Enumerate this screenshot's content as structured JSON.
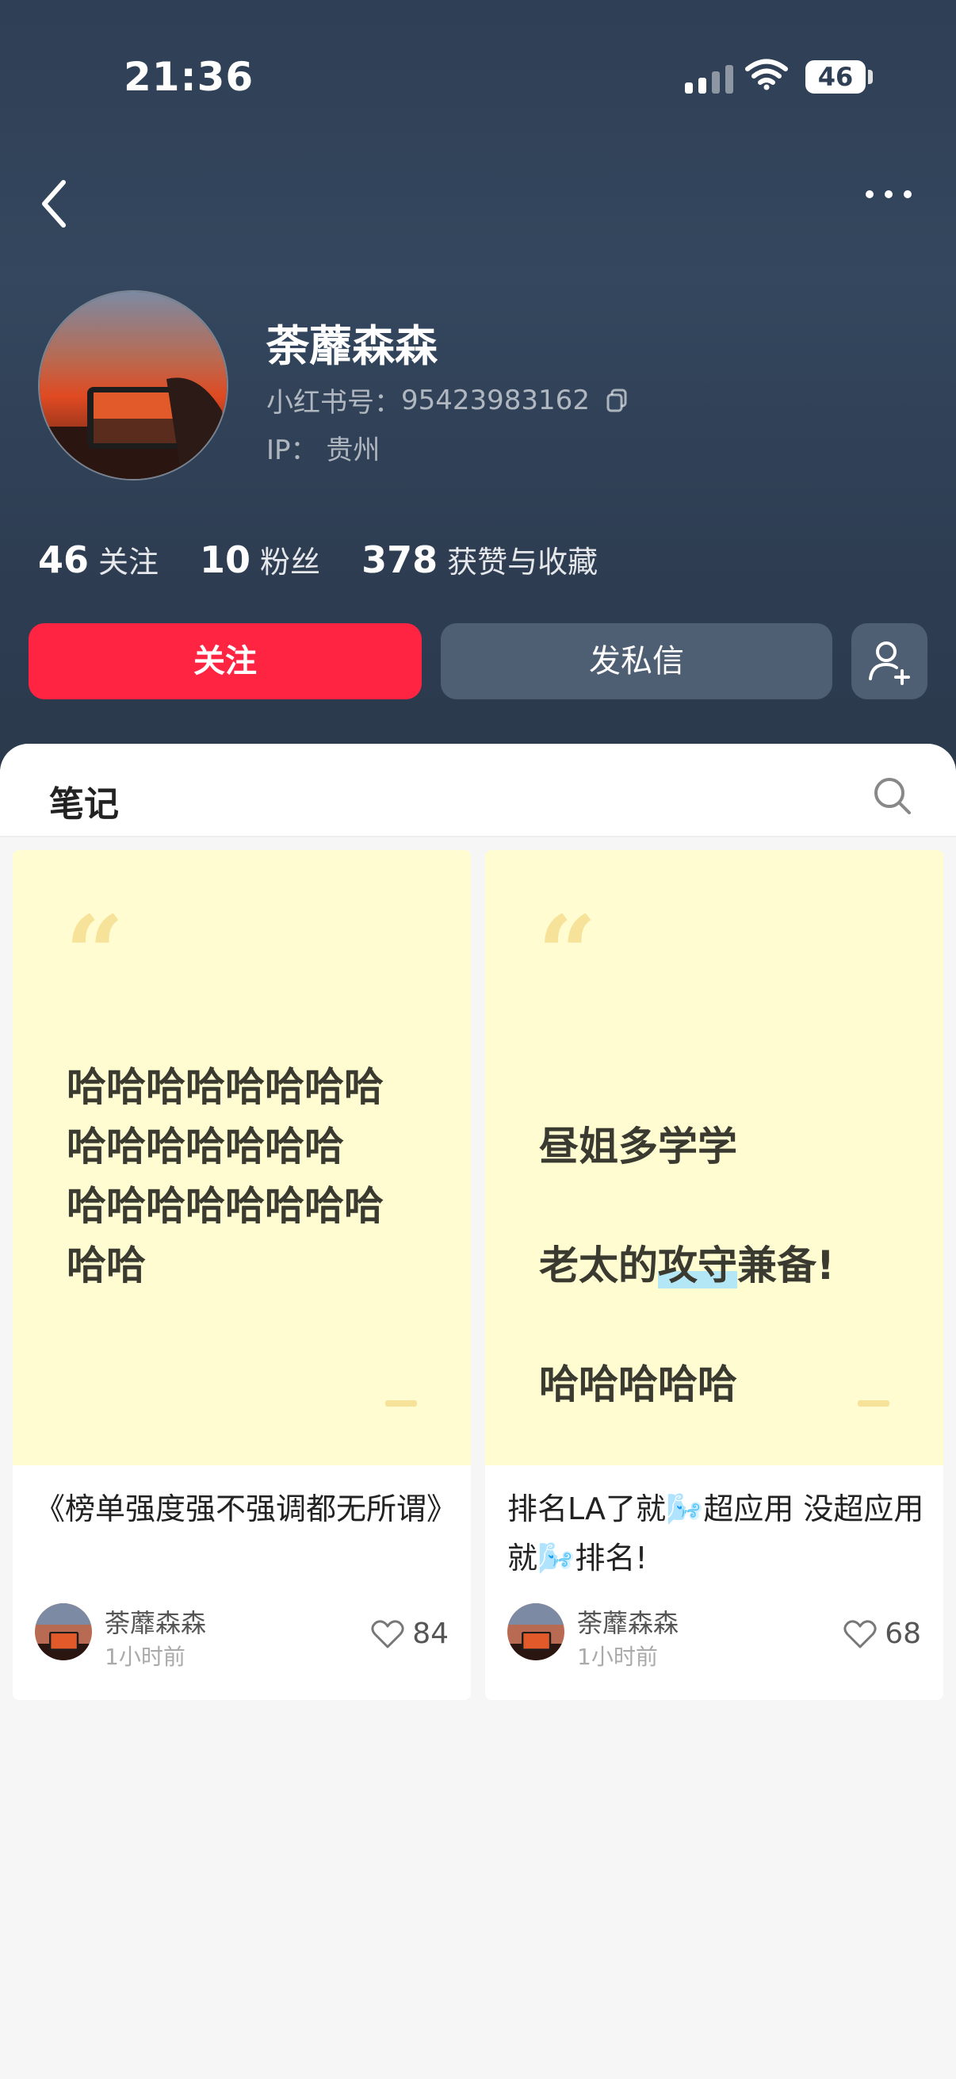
{
  "status_bar": {
    "time": "21:36",
    "battery": "46"
  },
  "profile": {
    "name": "荼蘼森森",
    "id_label": "小红书号：",
    "id_value": "95423983162",
    "ip_label": "IP：",
    "ip_value": "贵州"
  },
  "stats": [
    {
      "num": "46",
      "label": "关注"
    },
    {
      "num": "10",
      "label": "粉丝"
    },
    {
      "num": "378",
      "label": "获赞与收藏"
    }
  ],
  "actions": {
    "follow": "关注",
    "message": "发私信"
  },
  "tabs": {
    "notes": "笔记"
  },
  "notes": [
    {
      "cover_text": "哈哈哈哈哈哈哈哈\n哈哈哈哈哈哈哈\n哈哈哈哈哈哈哈哈\n哈哈",
      "title": "《榜单强度强不强调都无所谓》",
      "author": "荼蘼森森",
      "time": "1小时前",
      "likes": "84"
    },
    {
      "cover_line1": "昼姐多学学",
      "cover_line2_pre": "老太的",
      "cover_line2_hl": "攻守",
      "cover_line2_post": "兼备!",
      "cover_line3": "哈哈哈哈哈",
      "title": "排名LA了就🌬️超应用 没超应用就🌬️排名!",
      "author": "荼蘼森森",
      "time": "1小时前",
      "likes": "68"
    }
  ],
  "colors": {
    "accent": "#ff2442",
    "header_bg": "#2f3f55",
    "cover_bg": "#fefcd0"
  }
}
